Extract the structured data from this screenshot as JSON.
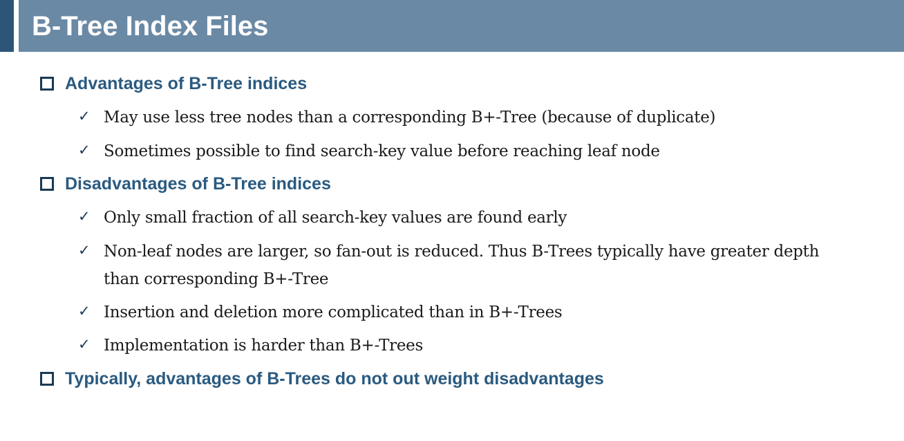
{
  "title": "B-Tree Index Files",
  "sections": [
    {
      "heading": "Advantages of B-Tree indices",
      "items": [
        "May use less tree nodes than a corresponding B+-Tree (because of duplicate)",
        "Sometimes possible to find search-key value before reaching leaf node"
      ]
    },
    {
      "heading": "Disadvantages of B-Tree indices",
      "items": [
        "Only small fraction of all search-key values are found early",
        "Non-leaf nodes are larger, so fan-out is reduced.  Thus B-Trees typically have greater depth than corresponding B+-Tree",
        "Insertion and deletion more complicated than in B+-Trees",
        "Implementation is harder than B+-Trees"
      ]
    },
    {
      "heading": "Typically, advantages of B-Trees do not out weight disadvantages",
      "items": []
    }
  ],
  "icons": {
    "level1": "square-bullet-icon",
    "level2": "checkmark-icon"
  },
  "colors": {
    "title_bar": "#6a89a5",
    "title_accent": "#2c5578",
    "heading_text": "#2a5a80"
  }
}
